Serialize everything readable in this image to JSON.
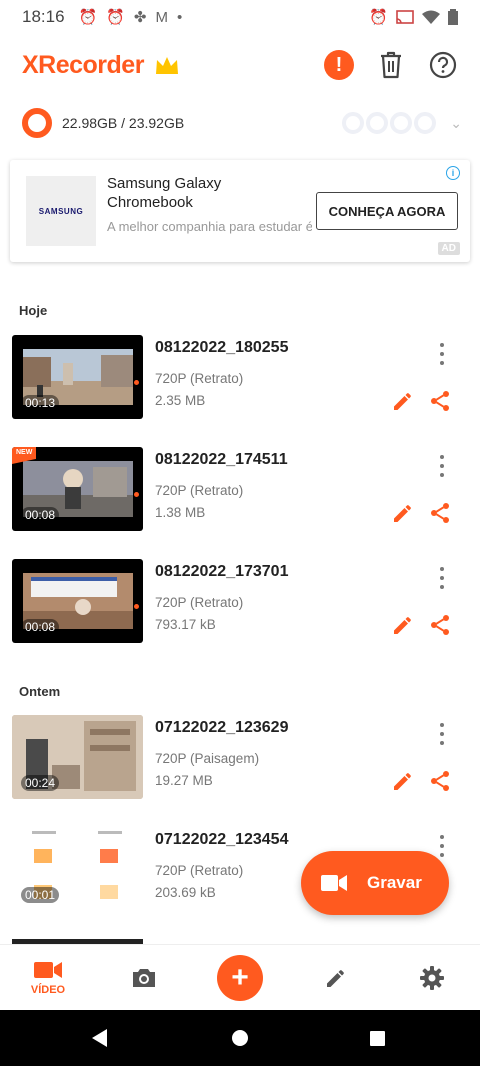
{
  "status_bar": {
    "time": "18:16"
  },
  "header": {
    "app_name": "XRecorder",
    "alert_symbol": "!"
  },
  "storage": {
    "text": "22.98GB / 23.92GB"
  },
  "ad": {
    "brand_logo_text": "SAMSUNG",
    "title": "Samsung Galaxy Chromebook",
    "description": "A melhor companhia para estudar é aquela que facilita o...",
    "cta": "CONHEÇA AGORA",
    "tag": "AD",
    "info": "i"
  },
  "sections": {
    "today": "Hoje",
    "yesterday": "Ontem"
  },
  "videos": [
    {
      "name": "08122022_180255",
      "resolution": "720P (Retrato)",
      "size": "2.35 MB",
      "duration": "00:13",
      "new": false
    },
    {
      "name": "08122022_174511",
      "resolution": "720P (Retrato)",
      "size": "1.38 MB",
      "duration": "00:08",
      "new": true,
      "new_label": "NEW"
    },
    {
      "name": "08122022_173701",
      "resolution": "720P (Retrato)",
      "size": "793.17 kB",
      "duration": "00:08",
      "new": false
    },
    {
      "name": "07122022_123629",
      "resolution": "720P (Paisagem)",
      "size": "19.27 MB",
      "duration": "00:24",
      "new": false
    },
    {
      "name": "07122022_123454",
      "resolution": "720P (Retrato)",
      "size": "203.69 kB",
      "duration": "00:01",
      "new": false
    }
  ],
  "fab": {
    "label": "Gravar"
  },
  "bottom_nav": {
    "video_label": "VÍDEO",
    "plus_symbol": "+"
  },
  "colors": {
    "accent": "#ff5a1f",
    "crown": "#ffc400"
  },
  "icons": [
    "alarm-icon",
    "fan-icon",
    "gmail-icon",
    "cast-icon",
    "wifi-icon",
    "battery-icon",
    "crown-icon",
    "alert-icon",
    "trash-icon",
    "help-icon",
    "chevron-down-icon",
    "more-vert-icon",
    "edit-icon",
    "share-icon",
    "video-camera-icon",
    "camera-icon",
    "plus-icon",
    "pencil-icon",
    "gear-icon"
  ]
}
